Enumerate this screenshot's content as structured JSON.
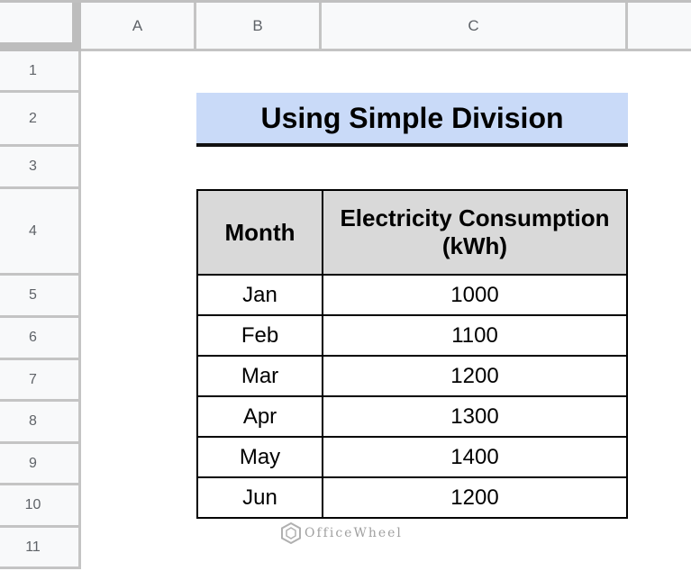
{
  "columns": [
    "A",
    "B",
    "C"
  ],
  "rows": [
    "1",
    "2",
    "3",
    "4",
    "5",
    "6",
    "7",
    "8",
    "9",
    "10",
    "11"
  ],
  "title": "Using Simple Division",
  "table": {
    "headers": [
      "Month",
      "Electricity Consumption (kWh)"
    ],
    "rows": [
      {
        "month": "Jan",
        "value": "1000"
      },
      {
        "month": "Feb",
        "value": "1100"
      },
      {
        "month": "Mar",
        "value": "1200"
      },
      {
        "month": "Apr",
        "value": "1300"
      },
      {
        "month": "May",
        "value": "1400"
      },
      {
        "month": "Jun",
        "value": "1200"
      }
    ]
  },
  "watermark": "OfficeWheel",
  "colors": {
    "title_fill": "#c9daf8",
    "header_fill": "#d9d9d9"
  }
}
